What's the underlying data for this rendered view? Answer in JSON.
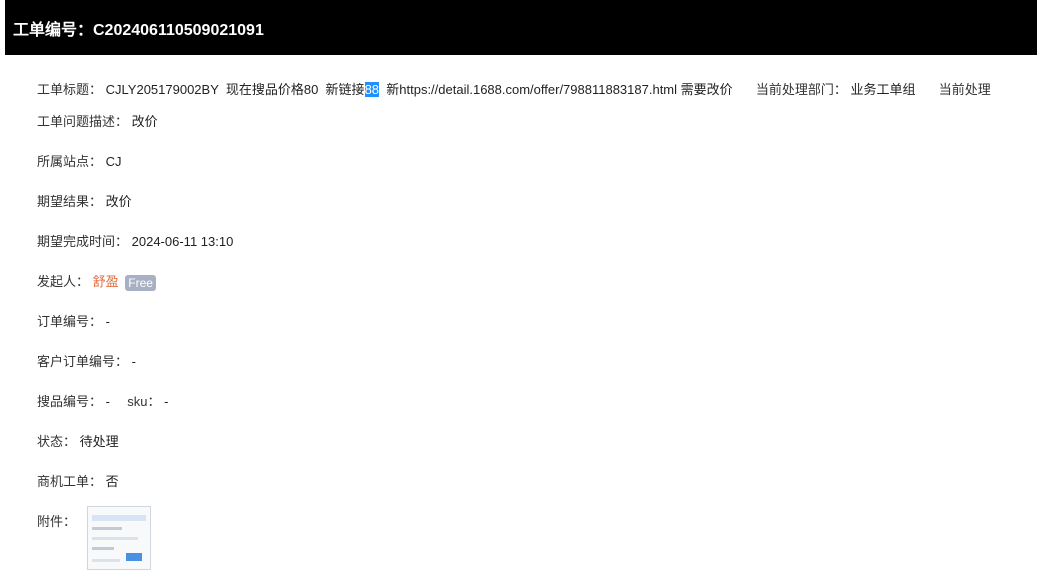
{
  "header": {
    "title": "工单编号：C202406110509021091"
  },
  "title_row": {
    "label": "工单标题：",
    "value_prefix": "CJLY205179002BY  现在搜品价格80  新链接",
    "value_selected": "88",
    "value_suffix": "  新https://detail.1688.com/offer/798811883187.html 需要改价",
    "dept_label": "当前处理部门：",
    "dept_value": "业务工单组",
    "handler_label": "当前处理"
  },
  "fields": {
    "issue_desc": {
      "label": "工单问题描述：",
      "value": "改价"
    },
    "site": {
      "label": "所属站点：",
      "value": "CJ"
    },
    "expected_result": {
      "label": "期望结果：",
      "value": "改价"
    },
    "expected_time": {
      "label": "期望完成时间：",
      "value": "2024-06-11 13:10"
    },
    "initiator": {
      "label": "发起人：",
      "value": "舒盈",
      "badge": "Free"
    },
    "order_no": {
      "label": "订单编号：",
      "value": "-"
    },
    "customer_order_no": {
      "label": "客户订单编号：",
      "value": "-"
    },
    "search_no": {
      "label": "搜品编号：",
      "value": "-",
      "sku_label": "sku：",
      "sku_value": "-"
    },
    "status": {
      "label": "状态：",
      "value": "待处理"
    },
    "opportunity": {
      "label": "商机工单：",
      "value": "否"
    },
    "attachment": {
      "label": "附件："
    }
  },
  "colors": {
    "header_bg": "#000000",
    "selection": "#1e90ff",
    "initiator_name": "#e06b3c",
    "badge_bg": "#a8b1c3"
  }
}
